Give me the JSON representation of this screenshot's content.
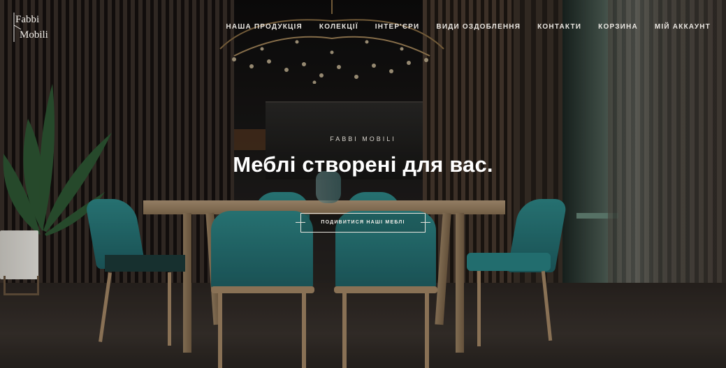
{
  "brand": {
    "logo_line1": "Fabbi",
    "logo_line2": "Mobili"
  },
  "nav": {
    "items": [
      {
        "label": "НАША ПРОДУКЦІЯ"
      },
      {
        "label": "КОЛЕКЦІЇ"
      },
      {
        "label": "ІНТЕР'ЄРИ"
      },
      {
        "label": "ВИДИ ОЗДОБЛЕННЯ"
      },
      {
        "label": "КОНТАКТИ"
      },
      {
        "label": "КОРЗИНА"
      },
      {
        "label": "МІЙ АККАУНТ"
      }
    ]
  },
  "hero": {
    "eyebrow": "FABBI MOBILI",
    "headline": "Меблі створені для вас.",
    "cta_label": "ПОДИВИТИСЯ НАШІ МЕБЛІ"
  },
  "colors": {
    "text": "#ffffff",
    "chair_teal": "#1f6a6c",
    "wood": "#a88a68"
  }
}
